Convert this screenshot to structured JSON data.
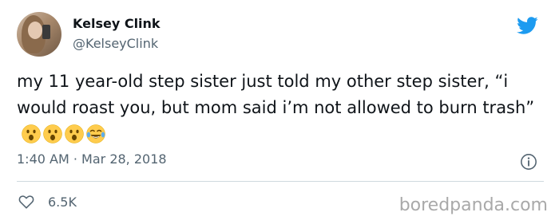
{
  "author": {
    "display_name": "Kelsey Clink",
    "handle": "@KelseyClink",
    "avatar_icon": "profile-photo"
  },
  "tweet": {
    "text": "my 11 year-old step sister just told my other step sister, “i would roast you, but mom said i’m not allowed to burn trash”",
    "emojis": [
      "face-with-open-mouth",
      "face-with-open-mouth",
      "face-with-open-mouth",
      "face-with-tears-of-joy"
    ]
  },
  "meta": {
    "time": "1:40 AM",
    "separator": "·",
    "date": "Mar 28, 2018"
  },
  "stats": {
    "likes": "6.5K"
  },
  "watermark": "boredpanda.com",
  "colors": {
    "twitter_blue": "#1d9bf0",
    "secondary_text": "#536471",
    "primary_text": "#0f1419",
    "divider": "#cfd9de"
  },
  "icons": {
    "logo": "twitter-bird-icon",
    "info": "info-icon",
    "like": "heart-icon"
  }
}
